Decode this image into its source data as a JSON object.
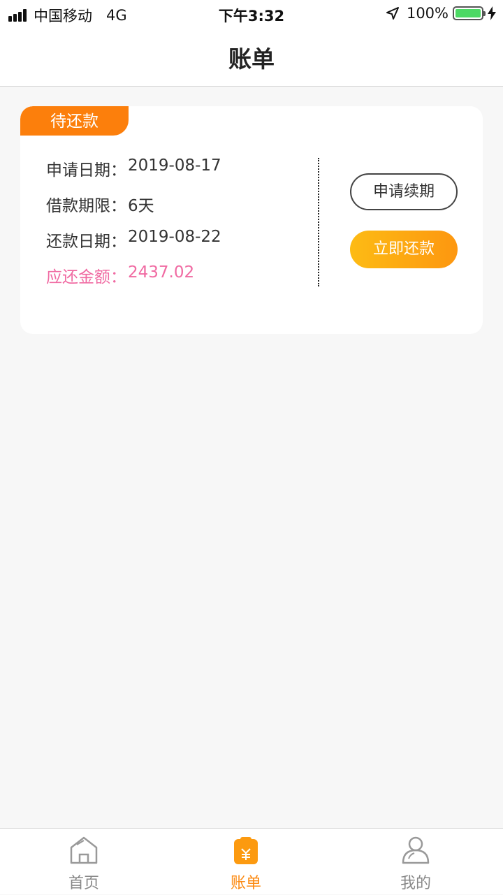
{
  "status_bar": {
    "carrier": "中国移动",
    "network": "4G",
    "time": "下午3:32",
    "battery": "100%",
    "battery_level": 1.0
  },
  "nav": {
    "title": "账单"
  },
  "bill": {
    "status_tag": "待还款",
    "rows": [
      {
        "label": "申请日期：",
        "value": "2019-08-17"
      },
      {
        "label": "借款期限：",
        "value": "6天"
      },
      {
        "label": "还款日期：",
        "value": "2019-08-22"
      },
      {
        "label": "应还金额：",
        "value": "2437.02"
      }
    ],
    "renew_button": "申请续期",
    "repay_button": "立即还款"
  },
  "tabs": [
    {
      "label": "首页",
      "icon": "home-icon"
    },
    {
      "label": "账单",
      "icon": "bill-icon"
    },
    {
      "label": "我的",
      "icon": "profile-icon"
    }
  ],
  "colors": {
    "accent": "#fc8a12",
    "amount": "#f06aa2",
    "tag": "#fc7f0c"
  }
}
